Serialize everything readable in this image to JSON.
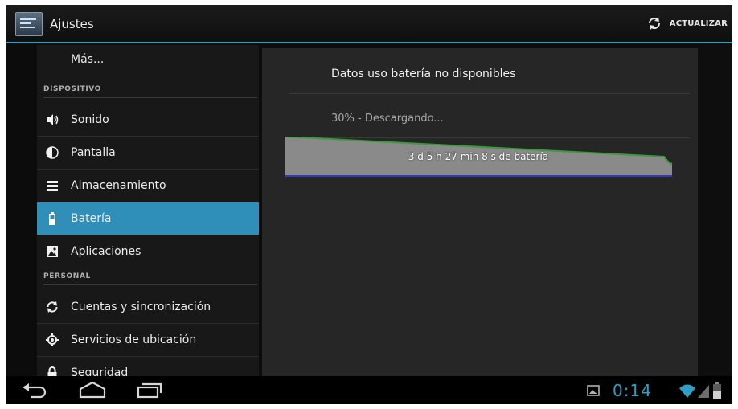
{
  "action_bar": {
    "title": "Ajustes",
    "refresh_label": "ACTUALIZAR",
    "icons": [
      "settings-app-icon",
      "refresh-icon"
    ]
  },
  "sidebar": {
    "items": [
      {
        "label": "Más...",
        "icon": ""
      },
      {
        "label": "Sonido",
        "icon": "speaker-icon"
      },
      {
        "label": "Pantalla",
        "icon": "brightness-icon"
      },
      {
        "label": "Almacenamiento",
        "icon": "storage-icon"
      },
      {
        "label": "Batería",
        "icon": "battery-icon",
        "selected": true
      },
      {
        "label": "Aplicaciones",
        "icon": "apps-icon"
      },
      {
        "label": "Cuentas y sincronización",
        "icon": "sync-icon"
      },
      {
        "label": "Servicios de ubicación",
        "icon": "location-icon"
      },
      {
        "label": "Seguridad",
        "icon": "lock-icon"
      }
    ],
    "sections": {
      "device": "DISPOSITIVO",
      "personal": "PERSONAL"
    }
  },
  "battery": {
    "unavailable_text": "Datos uso batería no disponibles",
    "status_text": "30% - Descargando...",
    "graph_label": "3 d 5 h 27 min 8 s de batería"
  },
  "system_bar": {
    "time": "0:14",
    "icons": [
      "back-icon",
      "home-icon",
      "recent-apps-icon",
      "screenshot-icon",
      "wifi-icon",
      "signal-icon",
      "battery-status-icon"
    ]
  },
  "colors": {
    "accent": "#2f9fc4",
    "selected": "#2f8fb9",
    "graph_fill": "#8a8a8a",
    "graph_line": "#3c9a3c",
    "graph_baseline": "#3a3ab0"
  }
}
